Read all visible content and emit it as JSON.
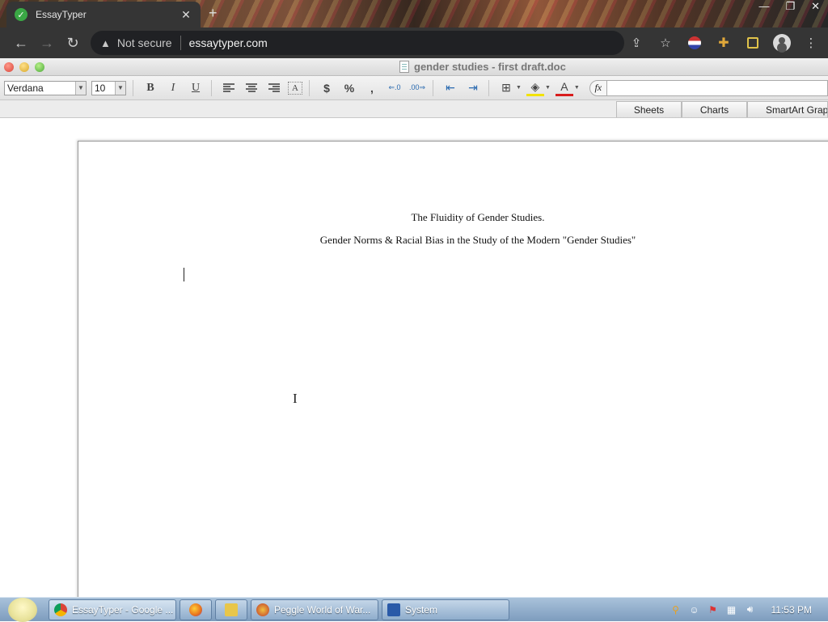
{
  "browser": {
    "tab": {
      "title": "EssayTyper",
      "close": "✕"
    },
    "new_tab": "+",
    "window_controls": {
      "minimize": "—",
      "restore": "❐",
      "close": "✕"
    },
    "security_label": "Not secure",
    "url": "essaytyper.com"
  },
  "office": {
    "doc_title": "gender studies - first draft.doc",
    "font": "Verdana",
    "font_size": "10",
    "format_buttons": {
      "bold": "B",
      "italic": "I",
      "underline": "U"
    },
    "currency_symbol": "$",
    "percent_symbol": "%",
    "comma_symbol": ",",
    "fx_label": "fx",
    "ribbon_tabs": [
      "Sheets",
      "Charts",
      "SmartArt Grap"
    ]
  },
  "document": {
    "title_line": "The Fluidity of Gender Studies.",
    "subtitle_line": "Gender Norms & Racial Bias in the Study of the Modern \"Gender Studies\""
  },
  "taskbar": {
    "tasks": [
      {
        "label": "EssayTyper - Google ...",
        "color": "#4285f4"
      },
      {
        "label": "",
        "color": "#e8711c"
      },
      {
        "label": "",
        "color": "#e8c64a"
      },
      {
        "label": "Peggle World of War...",
        "color": "#c0392b"
      },
      {
        "label": "System",
        "color": "#2a5aa8"
      }
    ],
    "clock": "11:53 PM"
  }
}
